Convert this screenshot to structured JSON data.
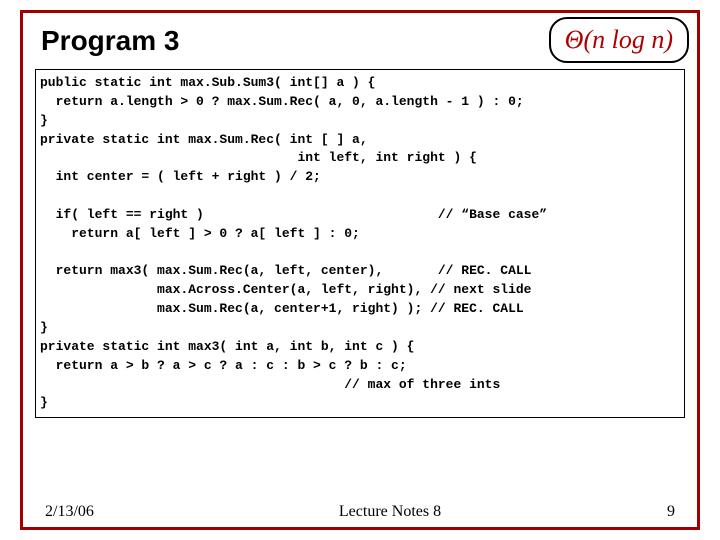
{
  "header": {
    "title": "Program 3",
    "complexity": "Θ(n log n)"
  },
  "code": {
    "text": "public static int max.Sub.Sum3( int[] a ) {\n  return a.length > 0 ? max.Sum.Rec( a, 0, a.length - 1 ) : 0;\n}\nprivate static int max.Sum.Rec( int [ ] a,\n                                 int left, int right ) {\n  int center = ( left + right ) / 2;\n\n  if( left == right )                              // “Base case”\n    return a[ left ] > 0 ? a[ left ] : 0;\n\n  return max3( max.Sum.Rec(a, left, center),       // REC. CALL\n               max.Across.Center(a, left, right), // next slide\n               max.Sum.Rec(a, center+1, right) ); // REC. CALL\n}\nprivate static int max3( int a, int b, int c ) {\n  return a > b ? a > c ? a : c : b > c ? b : c;\n                                       // max of three ints\n}"
  },
  "footer": {
    "date": "2/13/06",
    "center": "Lecture Notes 8",
    "page": "9"
  }
}
